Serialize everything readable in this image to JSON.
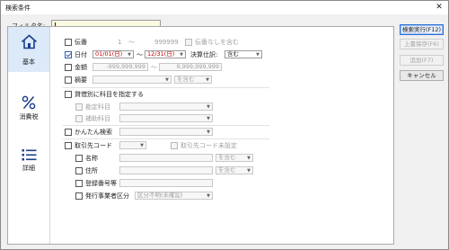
{
  "window": {
    "title": "検索条件",
    "close_glyph": "✕"
  },
  "filter_name": {
    "label": "フィルタ名:",
    "value": ""
  },
  "buttons": {
    "search": "検索実行(F12)",
    "overwrite": "上書保存(F6)",
    "add": "追加(F7)",
    "cancel": "キャンセル"
  },
  "sidebar": {
    "items": [
      {
        "label": "基本",
        "icon": "home-icon",
        "active": true
      },
      {
        "label": "消費税",
        "icon": "percent-icon",
        "active": false
      },
      {
        "label": "詳細",
        "icon": "list-icon",
        "active": false
      }
    ]
  },
  "form": {
    "slip_no": {
      "label": "伝番",
      "from": "1",
      "tilde": "～",
      "to": "999999",
      "no_slip_label": "伝番なしを含む"
    },
    "date": {
      "label": "日付",
      "from": "01/01(日)",
      "tilde": "～",
      "to": "12/31(日)",
      "settlement_label": "決算仕訳:",
      "settlement_value": "含む"
    },
    "amount": {
      "label": "金額",
      "from": "-999,999,999",
      "tilde": "～",
      "to": "9,999,999,999"
    },
    "description": {
      "label": "摘要",
      "mode": "を含む"
    },
    "account": {
      "label": "貸借別に科目を指定する",
      "debit": {
        "label": "勘定科目"
      },
      "sub": {
        "label": "補助科目"
      }
    },
    "kana_search": {
      "label": "かんたん検索"
    },
    "partner_code": {
      "label": "取引先コード",
      "unset_label": "取引先コード未設定"
    },
    "partner_name": {
      "label": "名称",
      "mode": "を含む"
    },
    "partner_address": {
      "label": "住所",
      "mode": "を含む"
    },
    "registration_no": {
      "label": "登録番号等"
    },
    "issuer_type": {
      "label": "発行事業者区分",
      "value": "区分不明(未確認)"
    }
  },
  "colors": {
    "accent": "#2b6fd6",
    "date_red": "#c00000",
    "filter_highlight": "#fafae0"
  }
}
